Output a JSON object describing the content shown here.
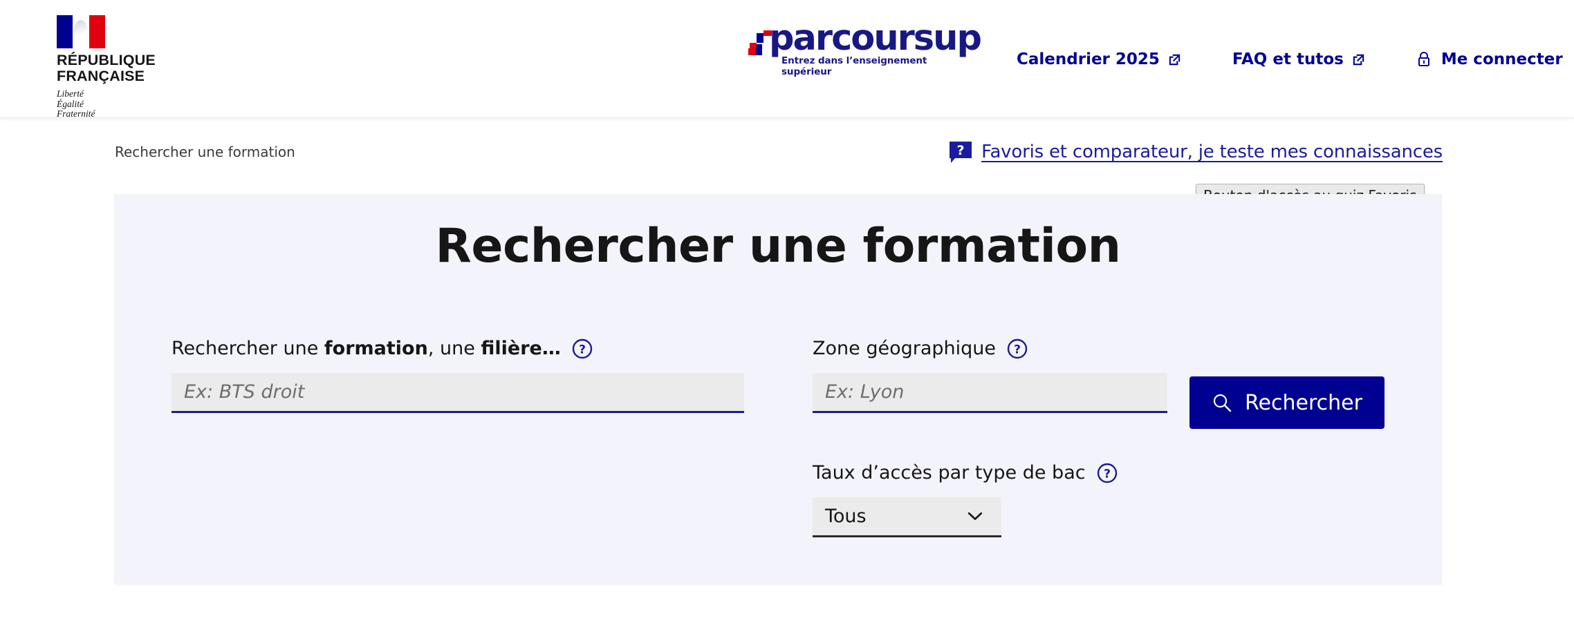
{
  "header": {
    "republic": {
      "title": "RÉPUBLIQUE\nFRANÇAISE",
      "motto": "Liberté\nÉgalité\nFraternité",
      "flag_icon": "marianne-flag-icon"
    },
    "brand": {
      "wordmark": "parcoursup",
      "tagline": "Entrez dans l’enseignement supérieur",
      "mark_icon": "parcoursup-arrow-icon"
    },
    "nav": [
      {
        "label": "Calendrier 2025",
        "icon": "external-link-icon"
      },
      {
        "label": "FAQ et tutos",
        "icon": "external-link-icon"
      },
      {
        "label": "Me connecter",
        "icon": "lock-icon"
      }
    ]
  },
  "breadcrumb": {
    "current": "Rechercher une formation"
  },
  "favorites": {
    "label": "Favoris et comparateur, je teste mes connaissances",
    "icon": "question-bubble-icon",
    "tooltip": "Bouton d'accès au quiz Favoris"
  },
  "search_panel": {
    "title": "Rechercher une formation",
    "fields": {
      "formation": {
        "label_prefix": "Rechercher une ",
        "label_bold_1": "formation",
        "label_mid": ", une ",
        "label_bold_2": "filière…",
        "help_icon": "help-circle-icon",
        "placeholder": "Ex: BTS droit",
        "value": ""
      },
      "zone": {
        "label": "Zone géographique",
        "help_icon": "help-circle-icon",
        "placeholder": "Ex: Lyon",
        "value": ""
      },
      "taux": {
        "label": "Taux d’accès par type de bac",
        "help_icon": "help-circle-icon",
        "selected": "Tous",
        "chevron_icon": "chevron-down-icon"
      }
    },
    "submit": {
      "label": "Rechercher",
      "icon": "search-icon"
    }
  },
  "colors": {
    "brand_navy": "#000091",
    "brand_red": "#e1000f",
    "panel_bg": "#f3f3fb",
    "input_bg": "#ebebeb",
    "link_blue": "#1b1b9e"
  }
}
